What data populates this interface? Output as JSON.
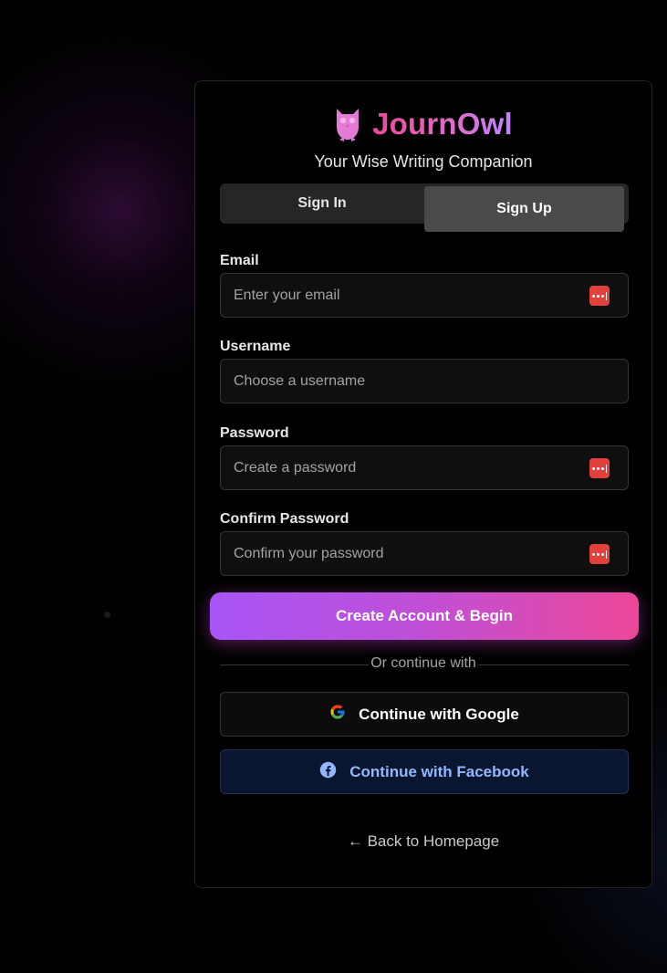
{
  "brand": {
    "name": "JournOwl",
    "tagline": "Your Wise Writing Companion",
    "icon": "owl-icon",
    "gradient_start": "#ec4899",
    "gradient_end": "#c084fc"
  },
  "tabs": [
    {
      "label": "Sign In",
      "active": false
    },
    {
      "label": "Sign Up",
      "active": true
    }
  ],
  "form": {
    "email": {
      "label": "Email",
      "placeholder": "Enter your email",
      "value": "",
      "icon": "password-manager-icon"
    },
    "username": {
      "label": "Username",
      "placeholder": "Choose a username",
      "value": ""
    },
    "password": {
      "label": "Password",
      "placeholder": "Create a password",
      "value": "",
      "icon": "password-manager-icon"
    },
    "confirm_password": {
      "label": "Confirm Password",
      "placeholder": "Confirm your password",
      "value": "",
      "icon": "password-manager-icon"
    }
  },
  "submit": {
    "label": "Create Account & Begin",
    "gradient_start": "#a855f7",
    "gradient_end": "#ec4899"
  },
  "divider_text": "Or continue with",
  "social": {
    "google": {
      "label": "Continue with Google",
      "icon": "google-icon"
    },
    "facebook": {
      "label": "Continue with Facebook",
      "icon": "facebook-icon",
      "color": "#93b7ff"
    }
  },
  "back_link": {
    "label": "← Back to Homepage"
  },
  "colors": {
    "background": "#000000",
    "password_manager_icon": "#e0413a"
  }
}
